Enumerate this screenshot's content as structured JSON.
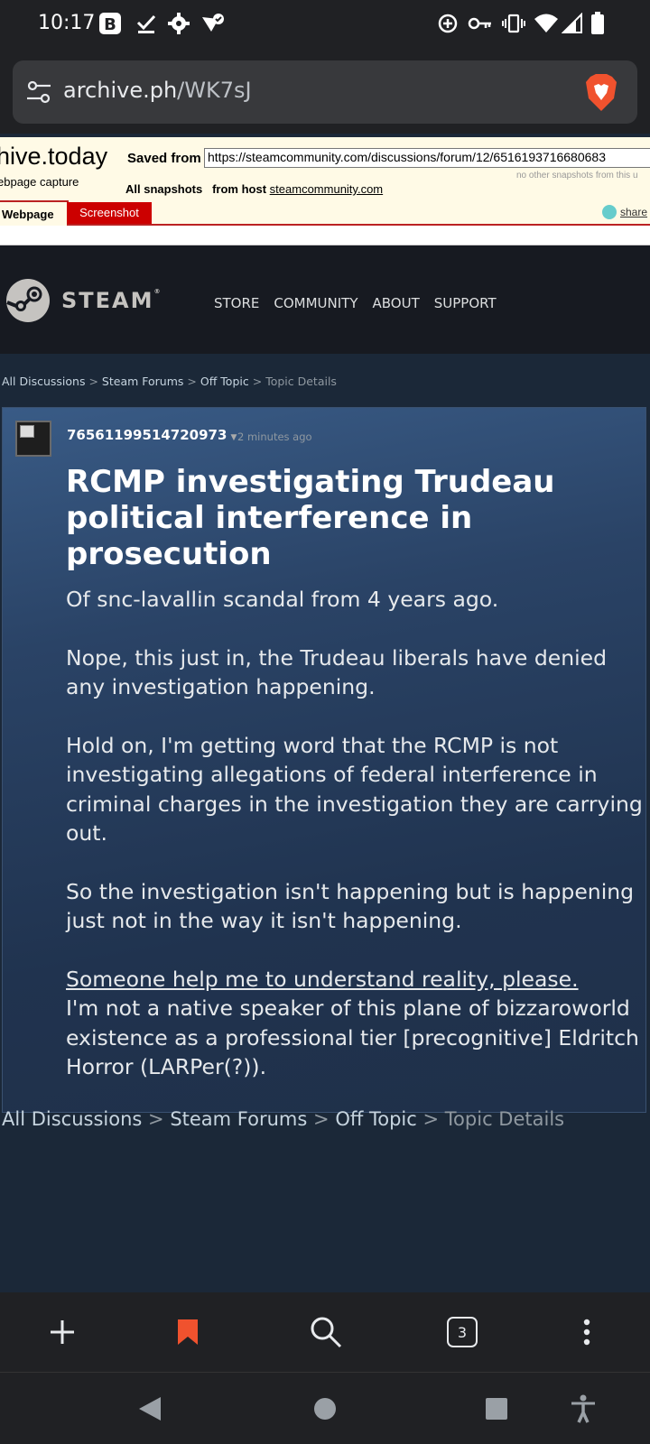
{
  "status_bar": {
    "time": "10:17",
    "left_icons": [
      "b-icon",
      "checkmark-icon",
      "gear-icon",
      "shield-icon"
    ],
    "right_icons": [
      "data-saver-icon",
      "key-icon",
      "vibrate-icon",
      "wifi-icon",
      "signal-icon",
      "battery-icon"
    ]
  },
  "browser": {
    "url_domain": "archive.ph",
    "url_path": "/WK7sJ"
  },
  "archive": {
    "brand": "hive.today",
    "subtitle": "ebpage capture",
    "saved_from_label": "Saved from",
    "saved_url": "https://steamcommunity.com/discussions/forum/12/6516193716680683",
    "note": "no other snapshots from this u",
    "all_snapshots_label": "All snapshots",
    "from_host_label": "from host",
    "host": "steamcommunity.com",
    "tab_webpage": "Webpage",
    "tab_screenshot": "Screenshot",
    "share_label": "share"
  },
  "steam": {
    "logo_text": "STEAM",
    "trademark": "®",
    "nav": [
      "STORE",
      "COMMUNITY",
      "ABOUT",
      "SUPPORT"
    ]
  },
  "breadcrumbs": {
    "items": [
      "All Discussions",
      "Steam Forums",
      "Off Topic"
    ],
    "current": "Topic Details",
    "separator": ">"
  },
  "topic": {
    "author": "76561199514720973",
    "time_ago": "2 minutes ago",
    "title": "RCMP investigating Trudeau political interference in prosecution",
    "paragraphs": [
      "Of snc-lavallin scandal from 4 years ago.",
      "Nope, this just in, the Trudeau liberals have denied any investigation happening.",
      "Hold on, I'm getting word that the RCMP is not investigating allegations of federal interference in criminal charges in the investigation they are carrying out.",
      "So the investigation isn't happening but is happening just not in the way it isn't happening."
    ],
    "underlined_line": "Someone help me to understand reality, please.",
    "final_text": "I'm not a native speaker of this plane of bizzaroworld existence as a professional tier [precognitive] Eldritch Horror (LARPer(?))."
  },
  "toolbar": {
    "tab_count": "3",
    "icons": [
      "plus-icon",
      "bookmark-icon",
      "search-icon",
      "tabs-icon",
      "more-icon"
    ],
    "bookmark_color": "#f0522e"
  },
  "colors": {
    "steam_bg": "#1b2838",
    "steam_header": "#171a21",
    "archive_bg": "#fffae6",
    "archive_accent": "#cc0000"
  }
}
